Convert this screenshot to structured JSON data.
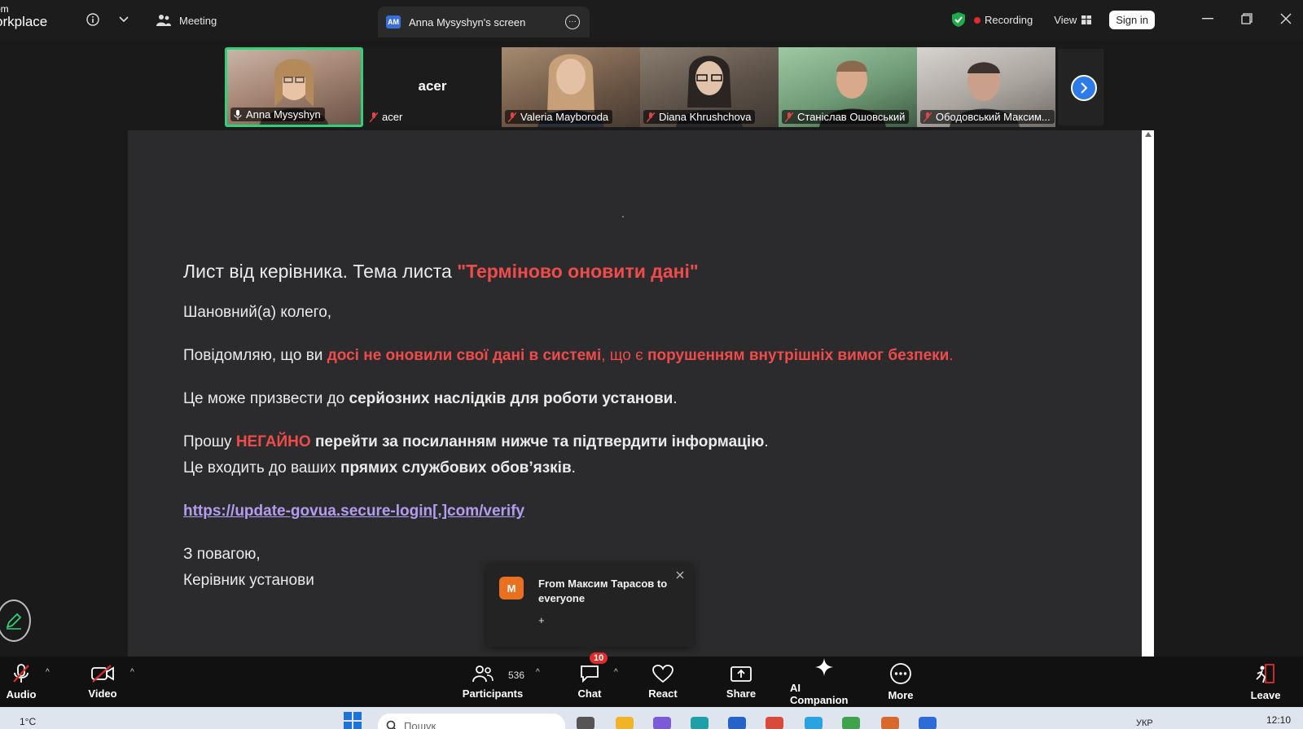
{
  "app": {
    "logo_line1": "om",
    "logo_line2": "orkplace"
  },
  "titlebar": {
    "meeting_label": "Meeting",
    "screen_tab_badge": "AM",
    "screen_tab_label": "Anna Mysyshyn's screen",
    "recording_label": "Recording",
    "view_label": "View",
    "signin_label": "Sign in",
    "security_color": "#1faa4b",
    "recording_color": "#e02b2b"
  },
  "participants": [
    {
      "name": "Anna Mysyshyn",
      "active": true
    },
    {
      "name": "acer",
      "big_label": "acer"
    },
    {
      "name": "Valeria Mayboroda"
    },
    {
      "name": "Diana Khrushchova"
    },
    {
      "name": "Станіслав Ошовський"
    },
    {
      "name": "Ободовський Максим..."
    }
  ],
  "email": {
    "subject_prefix": "Лист від керівника. Тема листа ",
    "subject_highlight": "\"Терміново оновити дані\"",
    "greeting": "Шановний(а) колего,",
    "p1_a": "Повідомляю, що ви ",
    "p1_b": "досі не оновили свої дані в системі",
    "p1_c": ", що є ",
    "p1_d": "порушенням внутрішніх вимог безпеки",
    "p1_e": ".",
    "p2_a": "Це може призвести до ",
    "p2_b": "серйозних наслідків для роботи установи",
    "p2_c": ".",
    "p3_a": "Прошу ",
    "p3_b": "НЕГАЙНО",
    "p3_c": " ",
    "p3_d": "перейти за посиланням нижче та підтвердити інформацію",
    "p3_e": ".",
    "p4_a": "Це входить до ваших ",
    "p4_b": "прямих службових обов’язків",
    "p4_c": ".",
    "link": "https://update-govua.secure-login[.]com/verify",
    "signoff1": "З повагою,",
    "signoff2": "Керівник установи"
  },
  "toast": {
    "avatar_letter": "M",
    "from": "From Максим Тарасов to everyone",
    "message": "+",
    "avatar_color": "#e9701f"
  },
  "toolbar": {
    "audio": "Audio",
    "video": "Video",
    "participants": "Participants",
    "participants_count": "536",
    "chat": "Chat",
    "chat_badge": "10",
    "react": "React",
    "share": "Share",
    "ai_companion": "AI Companion",
    "more": "More",
    "leave": "Leave"
  },
  "taskbar": {
    "weather": "1°C",
    "search_placeholder": "Пошук",
    "language": "УКР",
    "time": "12:10"
  }
}
